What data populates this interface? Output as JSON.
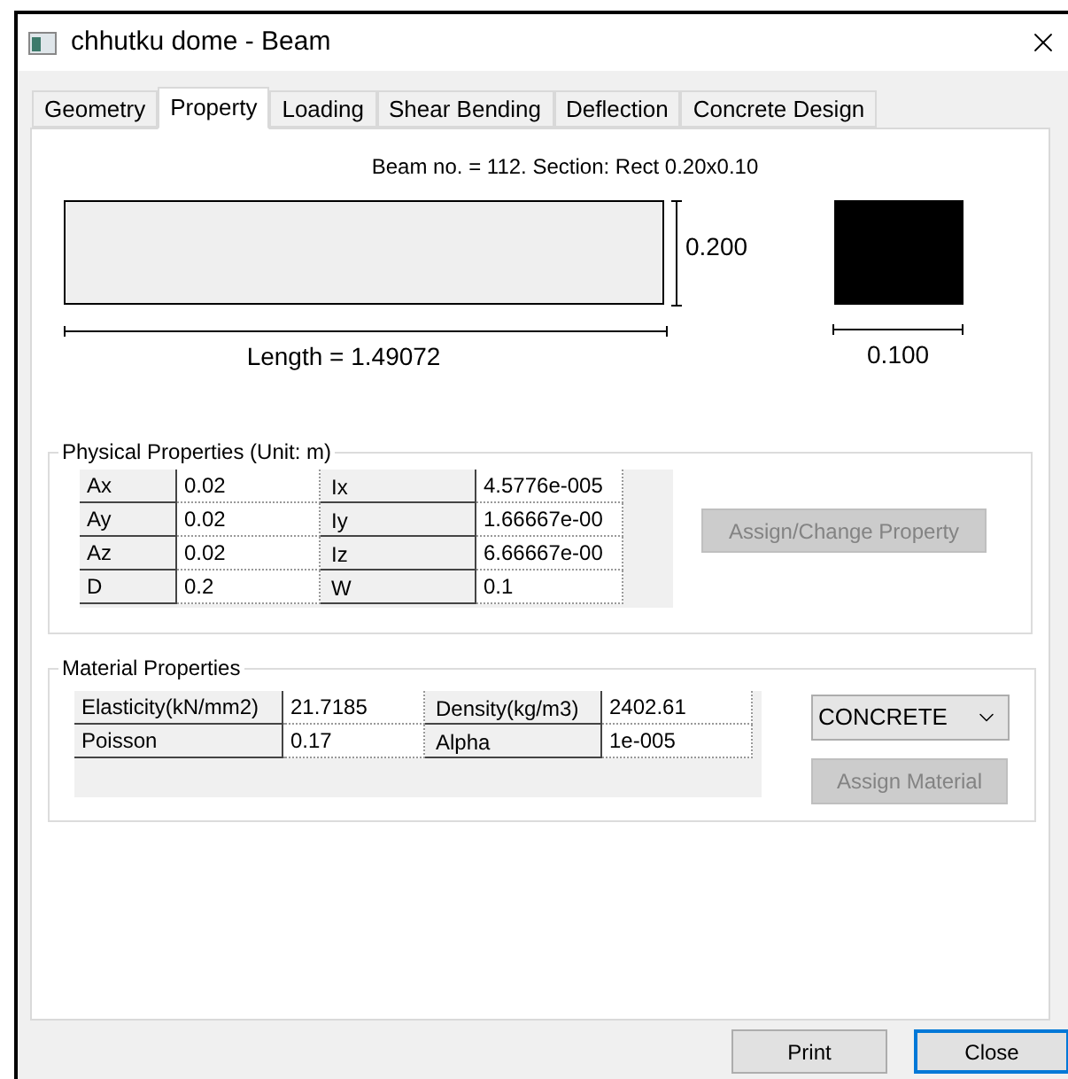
{
  "window": {
    "title": "chhutku dome - Beam"
  },
  "tabs": [
    {
      "label": "Geometry",
      "selected": false
    },
    {
      "label": "Property",
      "selected": true
    },
    {
      "label": "Loading",
      "selected": false
    },
    {
      "label": "Shear Bending",
      "selected": false
    },
    {
      "label": "Deflection",
      "selected": false
    },
    {
      "label": "Concrete Design",
      "selected": false
    }
  ],
  "property": {
    "beam_info": "Beam no. = 112. Section: Rect 0.20x0.10",
    "height_label": "0.200",
    "length_label": "Length = 1.49072",
    "width_label": "0.100",
    "physical": {
      "title": "Physical Properties (Unit: m)",
      "rows": [
        {
          "name": "Ax",
          "value": "0.02",
          "name_2": "Ix",
          "value_2": "4.5776e-005"
        },
        {
          "name": "Ay",
          "value": "0.02",
          "name_2": "Iy",
          "value_2": "1.66667e-00"
        },
        {
          "name": "Az",
          "value": "0.02",
          "name_2": "Iz",
          "value_2": "6.66667e-00"
        },
        {
          "name": "D",
          "value": "0.2",
          "name_2": "W",
          "value_2": "0.1"
        }
      ],
      "assign_button": {
        "label": "Assign/Change Property",
        "disabled": true
      }
    },
    "material": {
      "title": "Material Properties",
      "rows": [
        {
          "name": "Elasticity(kN/mm2)",
          "value": "21.7185",
          "name_2": "Density(kg/m3)",
          "value_2": "2402.61"
        },
        {
          "name": "Poisson",
          "value": "0.17",
          "name_2": "Alpha",
          "value_2": "1e-005"
        }
      ],
      "material_select": "CONCRETE",
      "assign_button": {
        "label": "Assign Material",
        "disabled": true
      }
    }
  },
  "buttons": [
    {
      "label": "Print",
      "focused": false
    },
    {
      "label": "Close",
      "focused": true
    }
  ]
}
